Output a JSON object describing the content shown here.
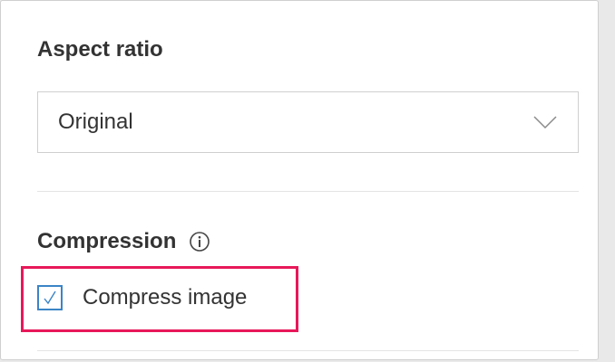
{
  "aspect_ratio": {
    "title": "Aspect ratio",
    "selected": "Original",
    "dropdown_icon": "chevron-down-icon"
  },
  "compression": {
    "title": "Compression",
    "info_icon": "info-icon",
    "checkbox_label": "Compress image",
    "checked": true
  },
  "colors": {
    "highlight": "#e8185a",
    "checkbox_accent": "#3b84c6"
  }
}
